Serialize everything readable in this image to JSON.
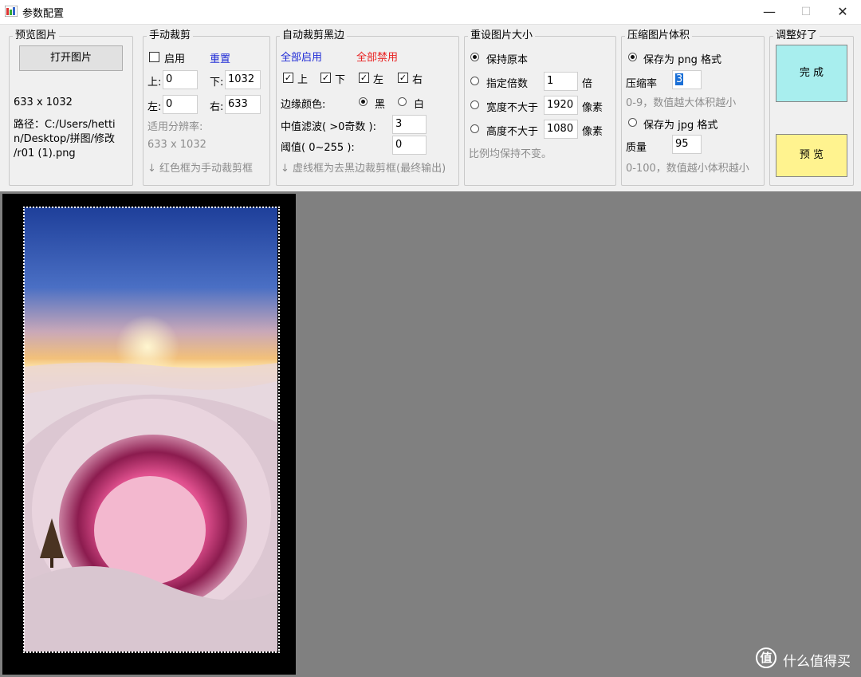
{
  "window": {
    "title": "参数配置",
    "min": "—",
    "max": "☐",
    "close": "✕"
  },
  "preview": {
    "group_title": "预览图片",
    "open_button": "打开图片",
    "size": "633 x 1032",
    "path_lines": [
      "路径：C:/Users/hettin/Desktop/拼图/修改/r01 (1).png"
    ],
    "path_l1": "路径：C:/Users/hetti",
    "path_l2": "n/Desktop/拼图/修改",
    "path_l3": "/r01 (1).png"
  },
  "manual": {
    "group_title": "手动裁剪",
    "enable_label": "启用",
    "reset_label": "重置",
    "top_label": "上:",
    "top_value": "0",
    "bottom_label": "下:",
    "bottom_value": "1032",
    "left_label": "左:",
    "left_value": "0",
    "right_label": "右:",
    "right_value": "633",
    "res_label": "适用分辨率:",
    "res_value": "633 x 1032",
    "hint": "↓ 红色框为手动裁剪框"
  },
  "auto": {
    "group_title": "自动裁剪黑边",
    "enable_all": "全部启用",
    "disable_all": "全部禁用",
    "sides": [
      "上",
      "下",
      "左",
      "右"
    ],
    "edge_color_label": "边缘颜色:",
    "black": "黑",
    "white": "白",
    "median_label": "中值滤波( >0奇数 ):",
    "median_value": "3",
    "threshold_label": "阈值( 0~255 ):",
    "threshold_value": "0",
    "hint": "↓ 虚线框为去黑边裁剪框(最终输出)"
  },
  "resize": {
    "group_title": "重设图片大小",
    "keep": "保持原本",
    "scale_label": "指定倍数",
    "scale_value": "1",
    "scale_unit": "倍",
    "width_label": "宽度不大于",
    "width_value": "1920",
    "width_unit": "像素",
    "height_label": "高度不大于",
    "height_value": "1080",
    "height_unit": "像素",
    "note": "比例均保持不变。"
  },
  "compress": {
    "group_title": "压缩图片体积",
    "png_label": "保存为 png 格式",
    "ratio_label": "压缩率",
    "ratio_value": "3",
    "png_hint": "0-9，数值越大体积越小",
    "jpg_label": "保存为 jpg 格式",
    "quality_label": "质量",
    "quality_value": "95",
    "jpg_hint": "0-100，数值越小体积越小"
  },
  "done": {
    "group_title": "调整好了",
    "finish": "完 成",
    "preview": "预 览",
    "finish_color": "#a8eeee",
    "preview_color": "#fff38f"
  },
  "watermark": {
    "icon": "值",
    "text": "什么值得买"
  }
}
